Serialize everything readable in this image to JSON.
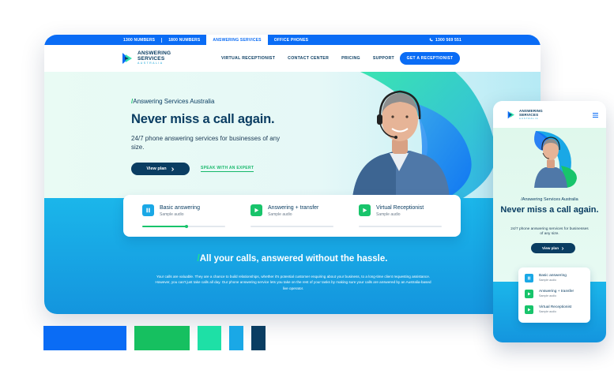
{
  "topbar": {
    "items": [
      "1300 NUMBERS",
      "1800 NUMBERS",
      "ANSWERING SERVICES",
      "OFFICE PHONES"
    ],
    "active_index": 2,
    "phone": "1300 569 551"
  },
  "brand": {
    "line1": "ANSWERING",
    "line2": "SERVICES",
    "line3": "AUSTRALIA"
  },
  "nav": {
    "items": [
      "VIRTUAL RECEPTIONIST",
      "CONTACT CENTER",
      "PRICING",
      "SUPPORT"
    ],
    "cta": "GET A RECEPTIONIST"
  },
  "hero": {
    "eyebrow_slash": "/",
    "eyebrow": "Answering Services Australia",
    "headline": "Never miss a call again.",
    "sub": "24/7 phone answering services for businesses of any size.",
    "btn_view": "View plan",
    "btn_expert": "SPEAK WITH AN EXPERT"
  },
  "audio": {
    "tracks": [
      {
        "name": "Basic answering",
        "note": "Sample audio",
        "state": "playing",
        "progress": 0.53
      },
      {
        "name": "Answering + transfer",
        "note": "Sample audio",
        "state": "paused",
        "progress": 0
      },
      {
        "name": "Virtual Receptionist",
        "note": "Sample audio",
        "state": "paused",
        "progress": 0
      }
    ]
  },
  "section": {
    "slash": "/",
    "tagline": "All your calls, answered without the hassle.",
    "paragraph": "Your calls are valuable. They are a chance to build relationships, whether it's potential customer enquiring about your business, to a long-time client requesting assistance. However, you can't just take calls all day. Our phone answering service lets you take on the rest of your tasks by making sure your calls are answered by an Australia-based live operator."
  },
  "mobile": {
    "brand": {
      "line1": "ANSWERING",
      "line2": "SERVICES",
      "line3": "AUSTRALIA"
    },
    "eyebrow": "/Answering Services Australia",
    "headline": "Never miss a call again.",
    "sub": "24/7 phone answering services for businesses of any size.",
    "btn_view": "View plan",
    "tracks": [
      {
        "name": "Basic answering",
        "note": "Sample audio"
      },
      {
        "name": "Answering + transfer",
        "note": "Sample audio"
      },
      {
        "name": "Virtual Receptionist",
        "note": "Sample audio"
      }
    ]
  },
  "palette": [
    "#0a6cf5",
    "#16c060",
    "#1ee0a6",
    "#1aa8e6",
    "#0a3d62"
  ],
  "icons": {
    "phone": "phone-icon",
    "chevron": "chevron-right-icon",
    "pause": "pause-icon",
    "play": "play-icon",
    "hamburger": "hamburger-menu-icon",
    "person": "operator-photo"
  }
}
